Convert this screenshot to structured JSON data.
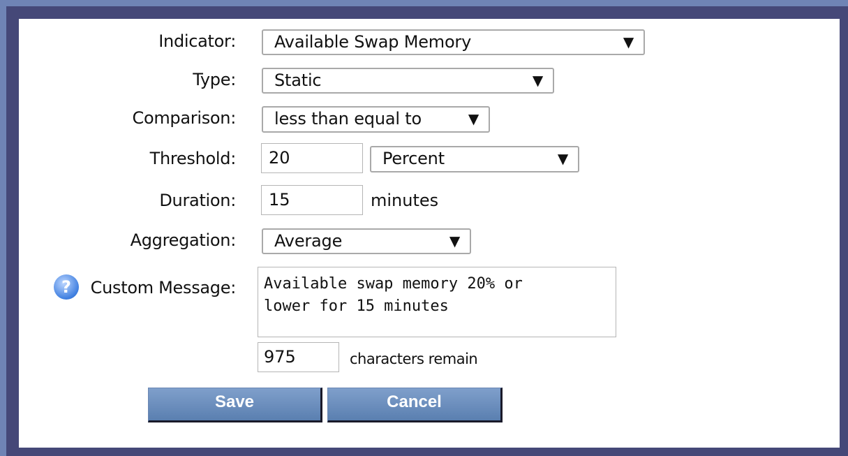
{
  "form": {
    "indicator": {
      "label": "Indicator:",
      "value": "Available Swap Memory"
    },
    "type": {
      "label": "Type:",
      "value": "Static"
    },
    "comparison": {
      "label": "Comparison:",
      "value": "less than equal to"
    },
    "threshold": {
      "label": "Threshold:",
      "value": "20",
      "unit": "Percent"
    },
    "duration": {
      "label": "Duration:",
      "value": "15",
      "unit": "minutes"
    },
    "aggregation": {
      "label": "Aggregation:",
      "value": "Average"
    },
    "custom_message": {
      "label": "Custom Message:",
      "value": "Available swap memory 20% or\nlower for 15 minutes",
      "remaining": "975",
      "remaining_label": "characters remain",
      "help_icon": "question-circle-icon"
    }
  },
  "buttons": {
    "save": "Save",
    "cancel": "Cancel"
  },
  "dropdown_arrow": "▼",
  "colors": {
    "border_light": "#6f84b5",
    "border_dark": "#454878",
    "button": "#6a8dbf"
  }
}
